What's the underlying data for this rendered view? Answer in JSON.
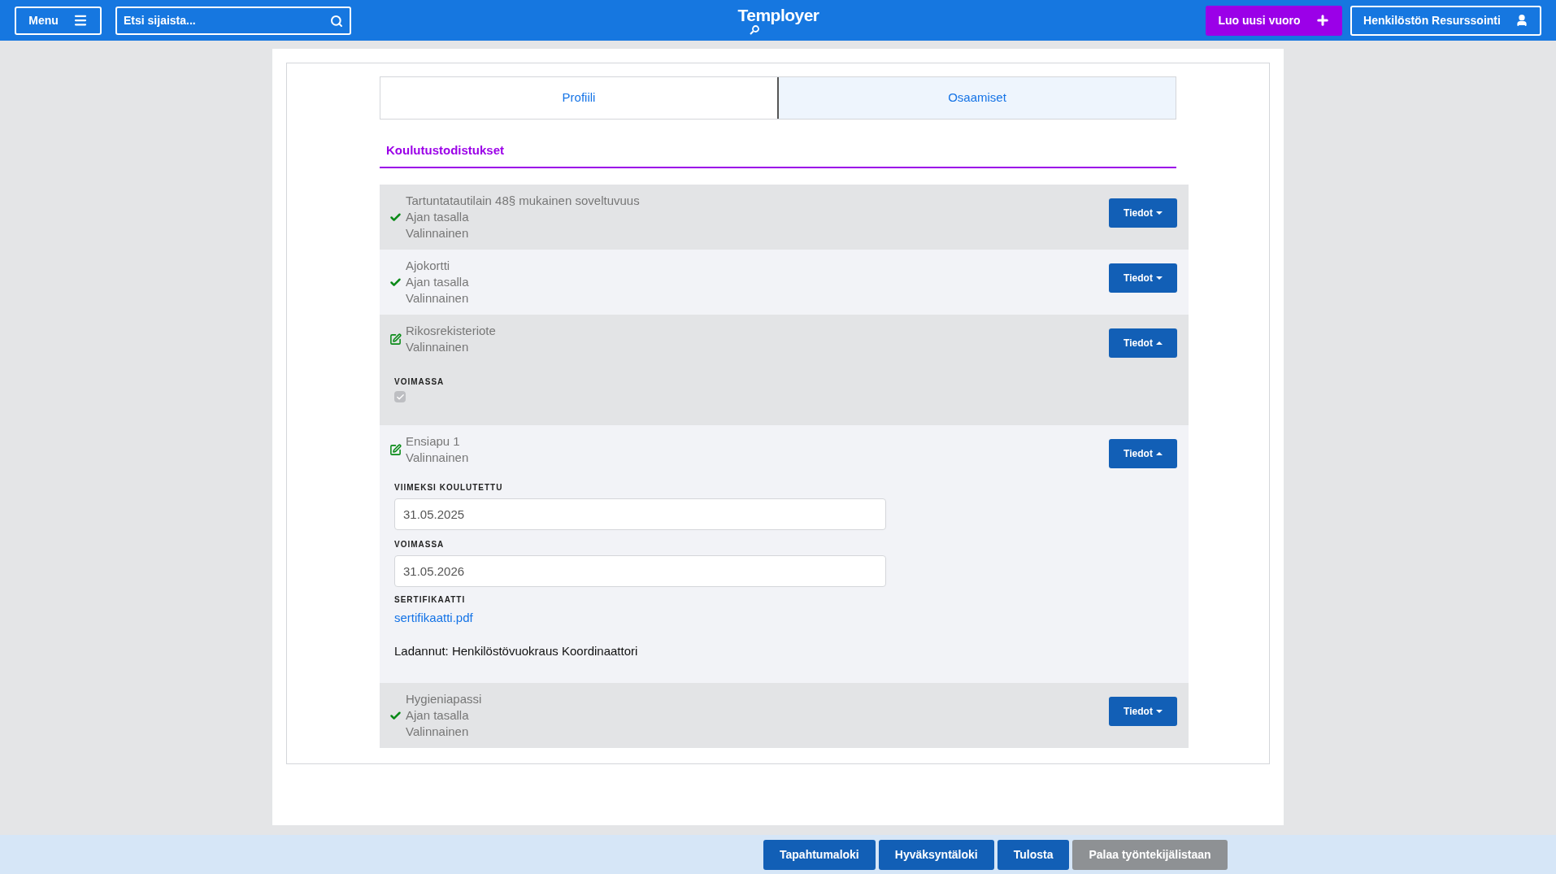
{
  "header": {
    "menu_button": "Menu",
    "search": {
      "placeholder": "Etsi sijaista..."
    },
    "logo": "Temployer",
    "new_shift_button": "Luo uusi vuoro",
    "user_button": "Henkilöstön Resurssointi"
  },
  "tabs": [
    {
      "label": "Profiili",
      "selected": false
    },
    {
      "label": "Osaamiset",
      "selected": true
    }
  ],
  "section_title": "Koulutustodistukset",
  "items": [
    {
      "kind": "check",
      "title": "Tartuntatautilain 48§ mukainen soveltuvuus",
      "status": "Ajan tasalla",
      "requirement": "Valinnainen",
      "button": "Tiedot",
      "expanded": false
    },
    {
      "kind": "check",
      "title": "Ajokortti",
      "status": "Ajan tasalla",
      "requirement": "Valinnainen",
      "button": "Tiedot",
      "expanded": false
    },
    {
      "kind": "edit",
      "title": "Rikosrekisteriote",
      "requirement": "Valinnainen",
      "button": "Tiedot",
      "expanded": true,
      "details": [
        {
          "kind": "checkbox",
          "label": "VOIMASSA",
          "checked": true
        }
      ]
    },
    {
      "kind": "edit",
      "title": "Ensiapu 1",
      "requirement": "Valinnainen",
      "button": "Tiedot",
      "expanded": true,
      "details": [
        {
          "kind": "field",
          "label": "VIIMEKSI KOULUTETTU",
          "value": "31.05.2025"
        },
        {
          "kind": "field",
          "label": "VOIMASSA",
          "value": "31.05.2026"
        },
        {
          "kind": "link",
          "label": "SERTIFIKAATTI",
          "value": "sertifikaatti.pdf"
        },
        {
          "kind": "note",
          "value": "Ladannut: Henkilöstövuokraus Koordinaattori"
        }
      ]
    },
    {
      "kind": "check",
      "title": "Hygieniapassi",
      "status": "Ajan tasalla",
      "requirement": "Valinnainen",
      "button": "Tiedot",
      "expanded": false
    }
  ],
  "footer_buttons": [
    {
      "label": "Tapahtumaloki",
      "kind": "primary"
    },
    {
      "label": "Hyväksyntäloki",
      "kind": "primary"
    },
    {
      "label": "Tulosta",
      "kind": "primary"
    },
    {
      "label": "Palaa työntekijälistaan",
      "kind": "secondary"
    }
  ]
}
